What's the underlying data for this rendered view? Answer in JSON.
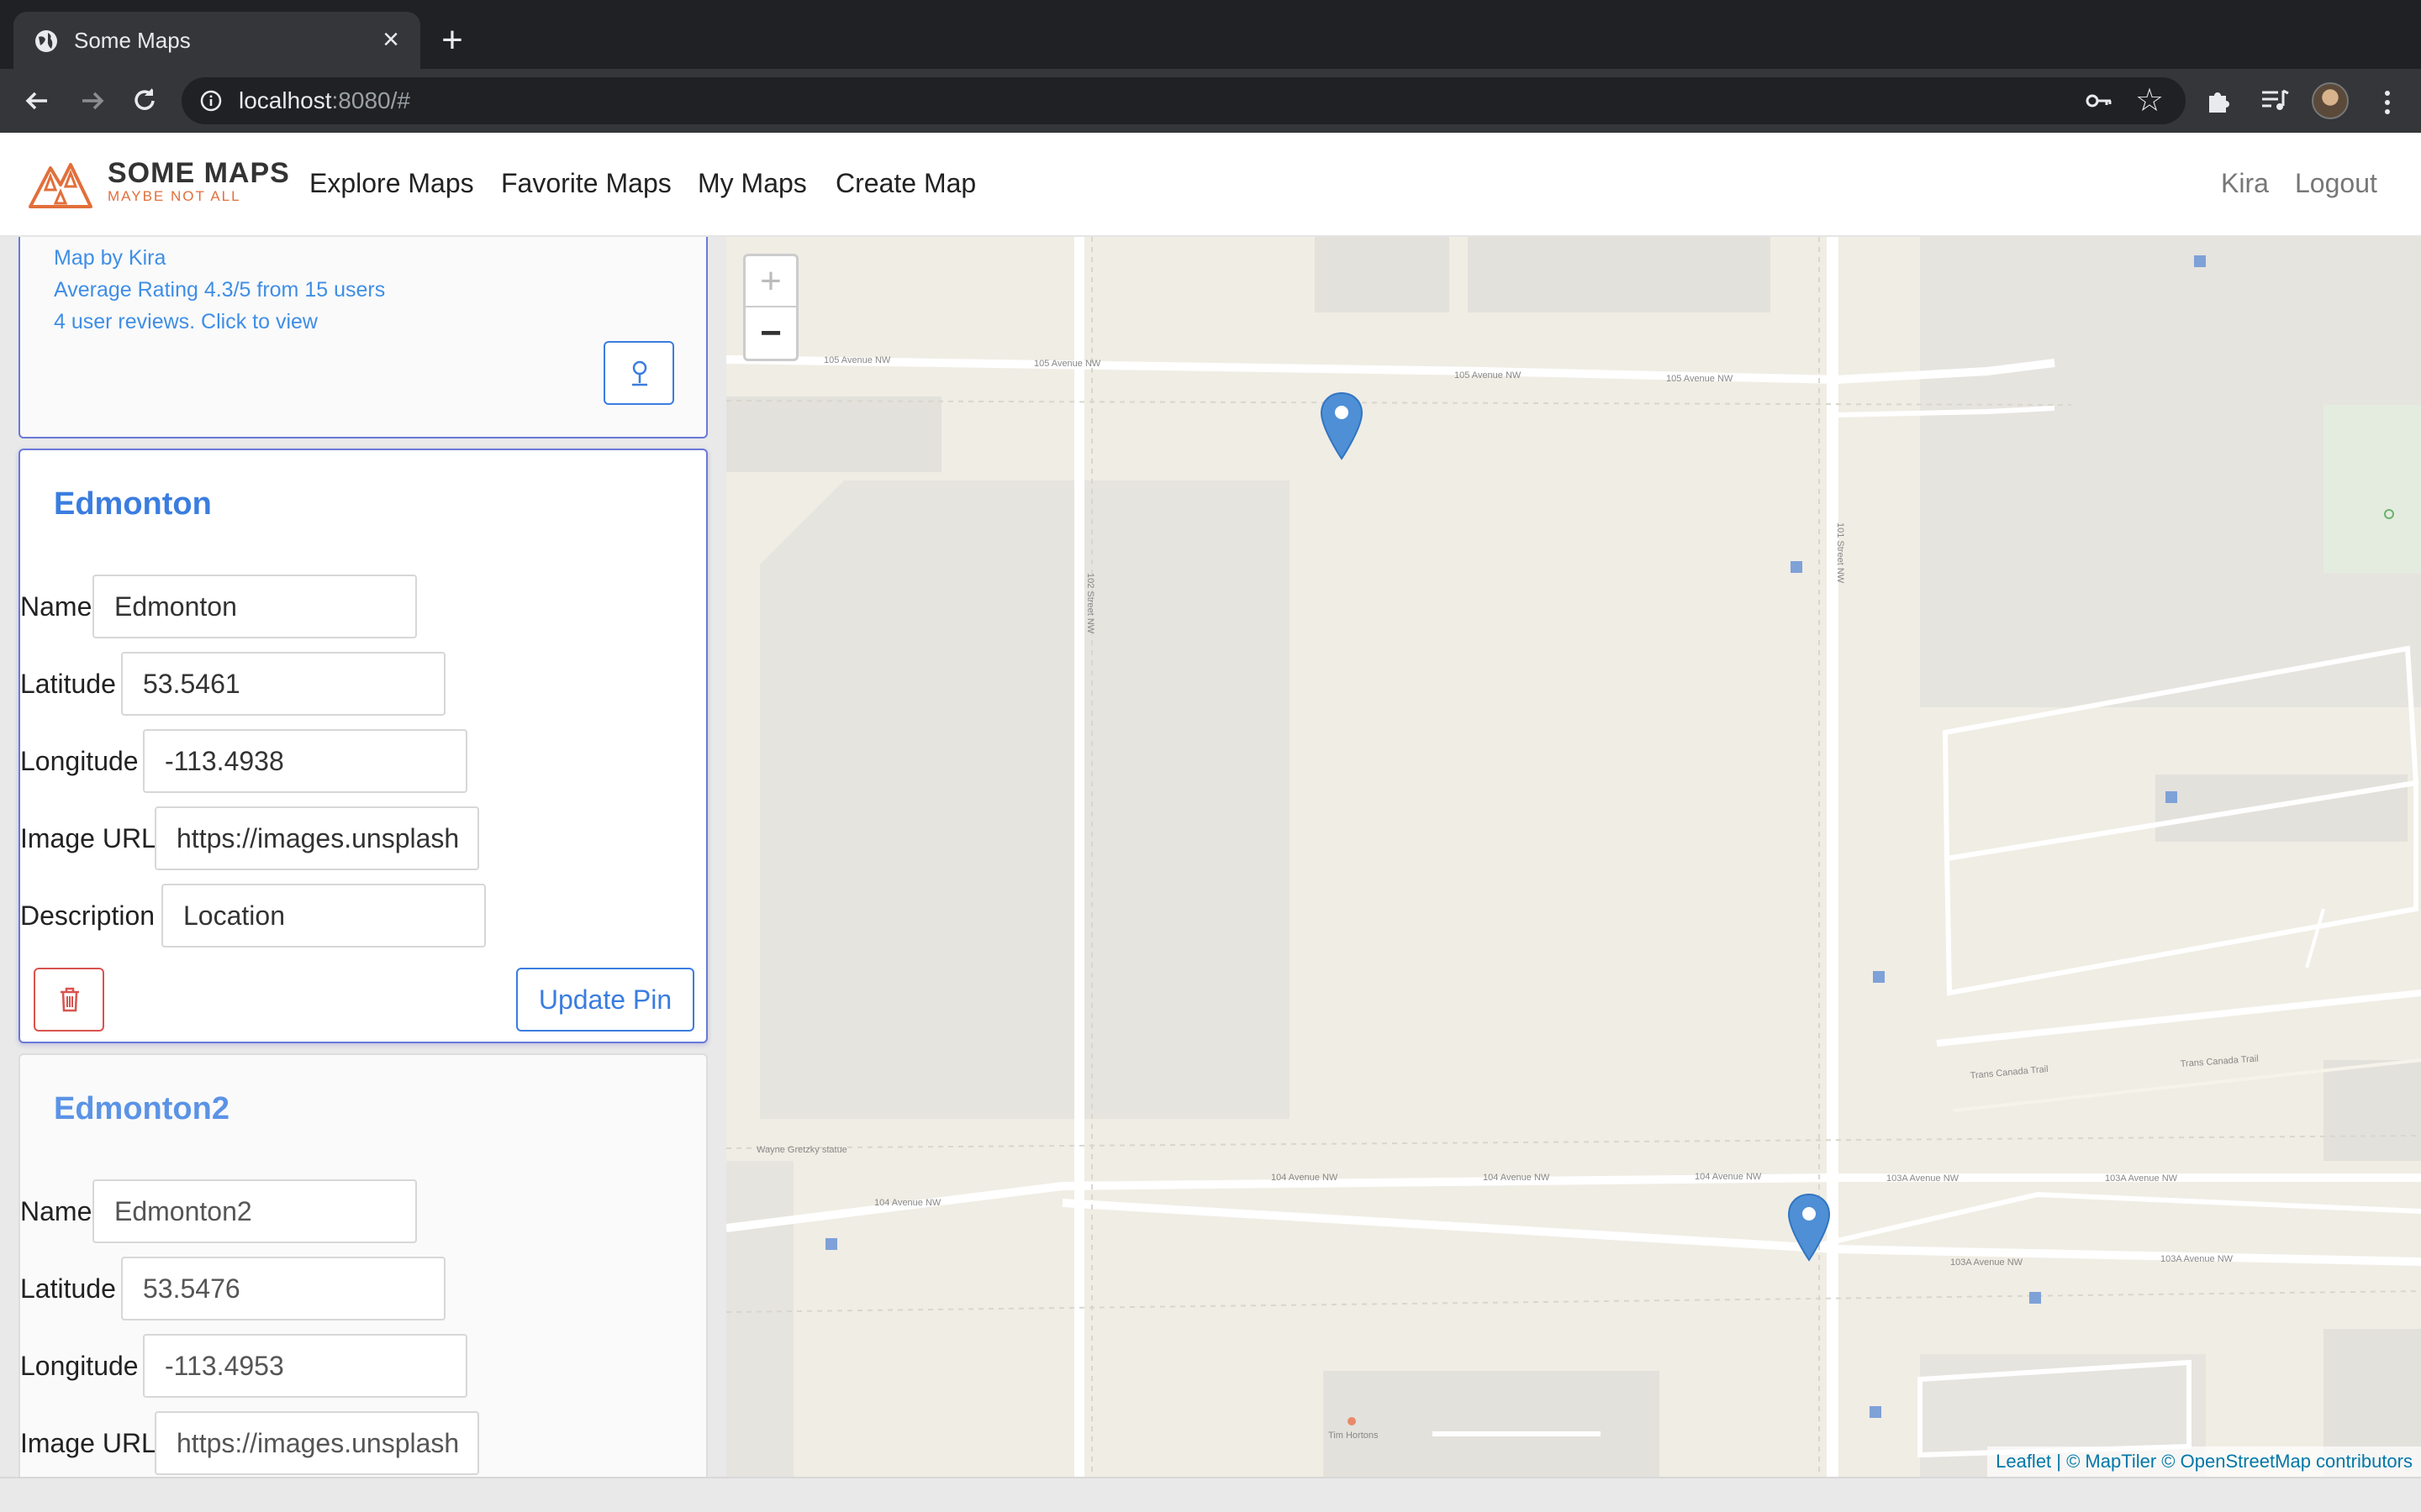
{
  "browser": {
    "tab_title": "Some Maps",
    "url_host": "localhost",
    "url_rest": ":8080/#"
  },
  "navbar": {
    "brand_name": "SOME MAPS",
    "brand_tagline": "MAYBE NOT ALL",
    "links": [
      "Explore Maps",
      "Favorite Maps",
      "My Maps",
      "Create Map"
    ],
    "user": "Kira",
    "logout": "Logout",
    "brand_color": "#e26f3b"
  },
  "map_info": {
    "author": "Map by Kira",
    "rating": "Average Rating 4.3/5 from 15 users",
    "reviews": "4 user reviews. Click to view"
  },
  "pins": [
    {
      "title": "Edmonton",
      "labels": {
        "name": "Name",
        "latitude": "Latitude",
        "longitude": "Longitude",
        "image_url": "Image URL",
        "description": "Description"
      },
      "name": "Edmonton",
      "latitude": "53.5461",
      "longitude": "-113.4938",
      "image_url": "https://images.unsplash",
      "description": "Location",
      "update_label": "Update Pin"
    },
    {
      "title": "Edmonton2",
      "labels": {
        "name": "Name",
        "latitude": "Latitude",
        "longitude": "Longitude",
        "image_url": "Image URL"
      },
      "name": "Edmonton2",
      "latitude": "53.5476",
      "longitude": "-113.4953",
      "image_url": "https://images.unsplash"
    }
  ],
  "map": {
    "zoom_in": "+",
    "zoom_out": "−",
    "attribution_leaflet": "Leaflet",
    "attribution_rest": " | © MapTiler © OpenStreetMap contributors",
    "street_labels": [
      "105 Avenue NW",
      "105 Avenue NW",
      "105 Avenue NW",
      "105 Avenue NW",
      "104 Avenue NW",
      "104 Avenue NW",
      "104 Avenue NW",
      "104 Avenue NW",
      "103A Avenue NW",
      "103A Avenue NW",
      "103A Avenue NW",
      "103A Avenue NW",
      "102 Street NW",
      "101 Street NW",
      "Trans Canada Trail",
      "Trans Canada Trail",
      "Wayne Gretzky statue",
      "Tim Hortons"
    ]
  }
}
